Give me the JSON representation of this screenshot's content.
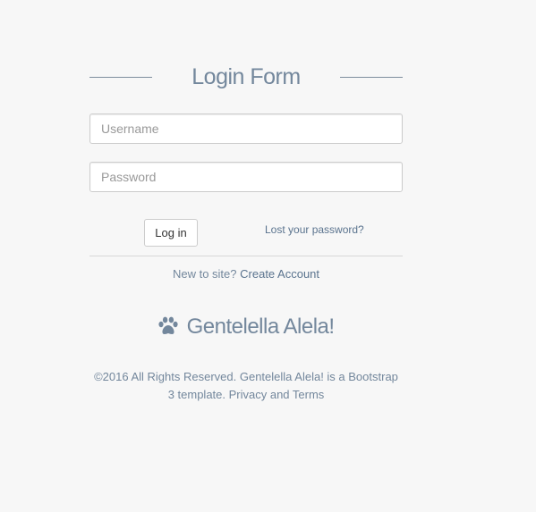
{
  "login_form": {
    "title": "Login Form",
    "username": {
      "value": "",
      "placeholder": "Username"
    },
    "password": {
      "value": "",
      "placeholder": "Password"
    },
    "login_button": "Log in",
    "lost_password_link": "Lost your password?",
    "new_to_site_text": "New to site?",
    "create_account_link": "Create Account"
  },
  "brand": {
    "icon": "paw-icon",
    "name": "Gentelella Alela!"
  },
  "footer": {
    "text": "©2016 All Rights Reserved. Gentelella Alela! is a Bootstrap 3 template. Privacy and Terms"
  },
  "colors": {
    "background": "#f7f7f7",
    "text": "#73879c",
    "link": "#5a738e"
  }
}
